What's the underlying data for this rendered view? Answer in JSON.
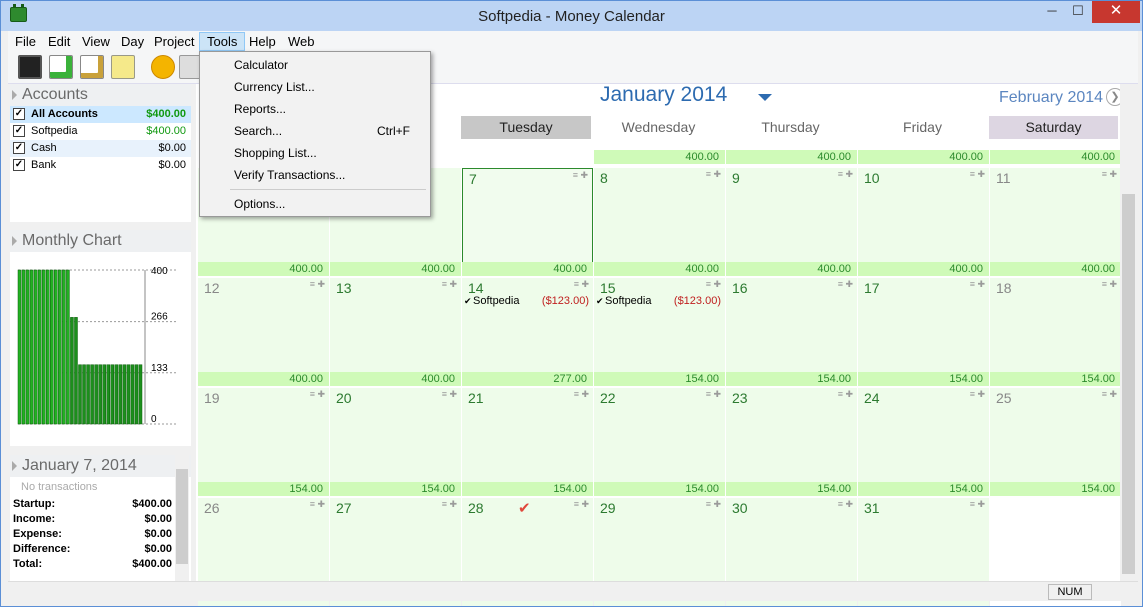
{
  "window": {
    "title": "Softpedia - Money Calendar",
    "min": "─",
    "max": "☐",
    "close": "✕"
  },
  "menu": [
    {
      "label": "File"
    },
    {
      "label": "Edit"
    },
    {
      "label": "View"
    },
    {
      "label": "Day"
    },
    {
      "label": "Project"
    },
    {
      "label": "Tools"
    },
    {
      "label": "Help"
    },
    {
      "label": "Web"
    }
  ],
  "tools_menu": {
    "calculator": "Calculator",
    "currency": "Currency List...",
    "reports": "Reports...",
    "search": "Search...",
    "search_shortcut": "Ctrl+F",
    "shopping": "Shopping List...",
    "verify": "Verify Transactions...",
    "options": "Options..."
  },
  "accounts": {
    "header": "Accounts",
    "rows": [
      {
        "name": "All Accounts",
        "value": "$400.00"
      },
      {
        "name": "Softpedia",
        "value": "$400.00"
      },
      {
        "name": "Cash",
        "value": "$0.00"
      },
      {
        "name": "Bank",
        "value": "$0.00"
      }
    ]
  },
  "chart": {
    "header": "Monthly Chart",
    "ticks": [
      "400",
      "266",
      "133",
      "0"
    ],
    "chart_data": {
      "type": "bar",
      "title": "Monthly Chart",
      "ylim": [
        0,
        400
      ],
      "yticks": [
        400,
        266,
        133,
        0
      ],
      "values": [
        400,
        400,
        400,
        400,
        400,
        400,
        400,
        400,
        400,
        400,
        400,
        400,
        400,
        277,
        277,
        154,
        154,
        154,
        154,
        154,
        154,
        154,
        154,
        154,
        154,
        154,
        154,
        154,
        154,
        154,
        154
      ]
    }
  },
  "day_panel": {
    "header": "January 7, 2014",
    "empty": "No transactions",
    "rows": [
      {
        "k": "Startup:",
        "v": "$400.00"
      },
      {
        "k": "Income:",
        "v": "$0.00"
      },
      {
        "k": "Expense:",
        "v": "$0.00"
      },
      {
        "k": "Difference:",
        "v": "$0.00"
      },
      {
        "k": "Total:",
        "v": "$400.00"
      }
    ]
  },
  "calendar": {
    "month": "January 2014",
    "next_month": "February 2014",
    "next_btn": "❯",
    "weekdays": [
      "Tuesday",
      "Wednesday",
      "Thursday",
      "Friday",
      "Saturday"
    ],
    "top_balances": [
      "400.00",
      "400.00",
      "400.00",
      "400.00"
    ],
    "weeks": [
      {
        "days": [
          "",
          "",
          "7",
          "8",
          "9",
          "10",
          "11"
        ],
        "balances": [
          "400.00",
          "400.00",
          "400.00",
          "400.00",
          "400.00",
          "400.00",
          "400.00"
        ]
      },
      {
        "days": [
          "12",
          "13",
          "14",
          "15",
          "16",
          "17",
          "18"
        ],
        "balances": [
          "400.00",
          "400.00",
          "277.00",
          "154.00",
          "154.00",
          "154.00",
          "154.00"
        ]
      },
      {
        "days": [
          "19",
          "20",
          "21",
          "22",
          "23",
          "24",
          "25"
        ],
        "balances": [
          "154.00",
          "154.00",
          "154.00",
          "154.00",
          "154.00",
          "154.00",
          "154.00"
        ]
      },
      {
        "days": [
          "26",
          "27",
          "28",
          "29",
          "30",
          "31",
          ""
        ],
        "balances": []
      }
    ],
    "txn14": {
      "name": "Softpedia",
      "amount": "($123.00)"
    },
    "txn15": {
      "name": "Softpedia",
      "amount": "($123.00)"
    }
  },
  "status": {
    "num": "NUM"
  },
  "colors": {
    "accent": "#2d6bb0",
    "cell_bg": "#eefcea",
    "balance_bg": "#cffab8",
    "bar": "#22aa22",
    "close": "#c7372f"
  }
}
